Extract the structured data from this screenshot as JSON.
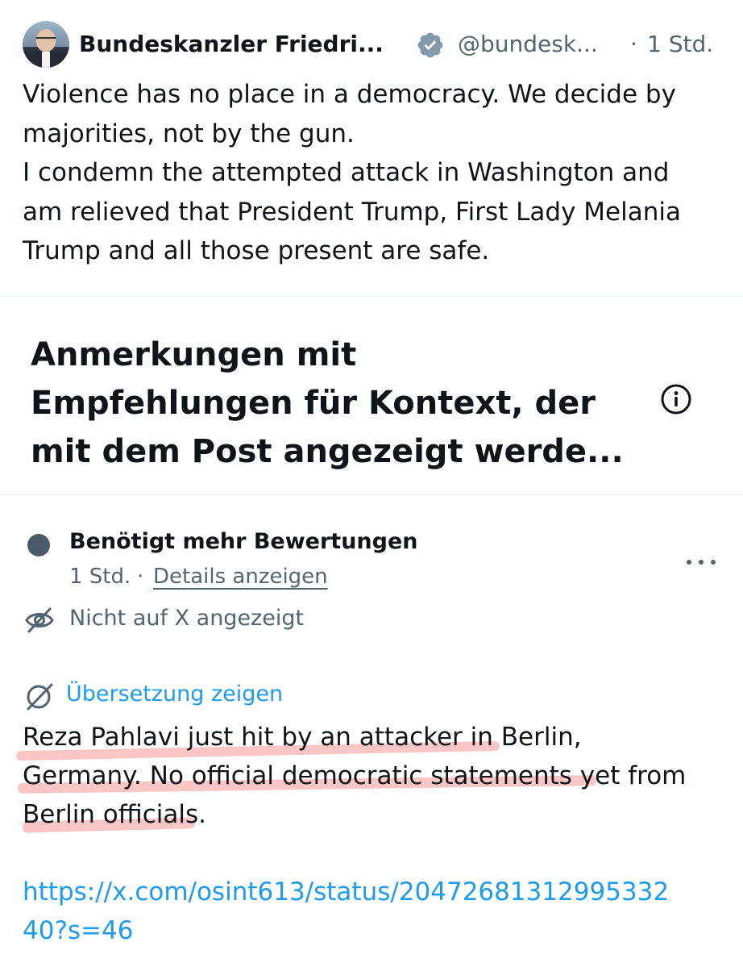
{
  "tweet": {
    "author_name": "Bundeskanzler Friedri...",
    "handle": "@bundesk...",
    "separator": "·",
    "time": "1 Std.",
    "text_lines": [
      "Violence has no place in a democracy. We decide by",
      "majorities, not by the gun.",
      "I condemn the attempted attack in Washington and",
      "am relieved that President Trump, First Lady Melania",
      "Trump and all those present are safe."
    ]
  },
  "notes": {
    "title_lines": [
      "Anmerkungen mit",
      "Empfehlungen für Kontext, der",
      "mit dem Post angezeigt werde..."
    ],
    "note": {
      "status": "Benötigt mehr Bewertungen",
      "time": "1 Std.",
      "separator": "·",
      "details_link": "Details anzeigen",
      "visibility": "Nicht auf X angezeigt",
      "translate_link": "Übersetzung zeigen",
      "text_lines": [
        "Reza Pahlavi just hit by an attacker in Berlin,",
        "Germany. No official democratic statements yet from",
        "Berlin officials."
      ],
      "url_lines": [
        "https://x.com/osint613/status/20472681312995332",
        "40?s=46"
      ]
    }
  },
  "colors": {
    "secondary_text": "#536471",
    "link": "#1d9bf0",
    "status_dot": "#4b5a68",
    "highlight": "#f37878"
  },
  "icons": [
    "verified-badge-icon",
    "info-icon",
    "more-icon",
    "eye-off-icon",
    "translate-icon"
  ]
}
